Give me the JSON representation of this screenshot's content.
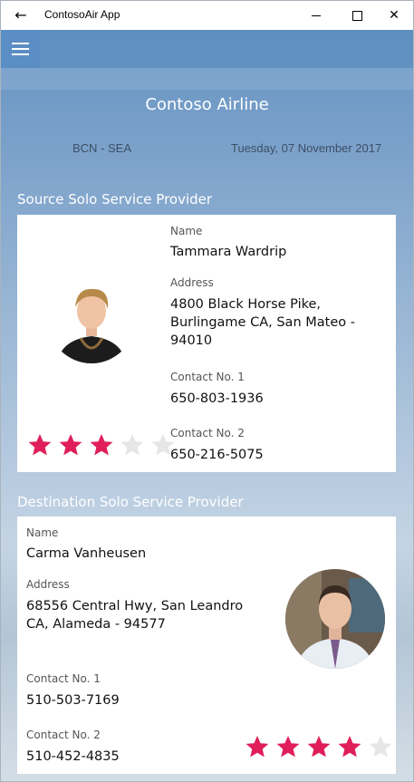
{
  "window": {
    "title": "ContosoAir App"
  },
  "header": {
    "app_name": "Contoso Airline",
    "route": "BCN - SEA",
    "date": "Tuesday, 07 November 2017"
  },
  "source": {
    "section_title": "Source Solo Service Provider",
    "name_label": "Name",
    "name": "Tammara Wardrip",
    "address_label": "Address",
    "address_line1": "4800 Black Horse Pike,",
    "address_line2": "Burlingame CA, San Mateo -",
    "address_line3": "94010",
    "contact1_label": "Contact No. 1",
    "contact1": "650-803-1936",
    "contact2_label": "Contact No. 2",
    "contact2": "650-216-5075",
    "rating": 3,
    "rating_max": 5
  },
  "destination": {
    "section_title": "Destination Solo Service Provider",
    "name_label": "Name",
    "name": "Carma Vanheusen",
    "address_label": "Address",
    "address_line1": "68556 Central Hwy, San Leandro",
    "address_line2": "CA, Alameda - 94577",
    "contact1_label": "Contact No. 1",
    "contact1": "510-503-7169",
    "contact2_label": "Contact No. 2",
    "contact2": "510-452-4835",
    "rating": 4,
    "rating_max": 5
  },
  "colors": {
    "accent": "#5b8ec4",
    "star_filled": "#e01e5a",
    "star_empty": "#e6e6e6"
  }
}
